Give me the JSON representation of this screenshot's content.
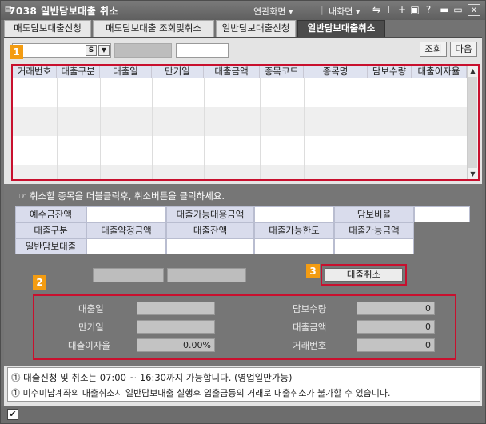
{
  "window": {
    "title": "7038 일반담보대출 취소",
    "menu_related": "연관화면",
    "menu_my": "내화면",
    "close": "x"
  },
  "tabs": [
    {
      "label": "매도담보대출신청",
      "active": false
    },
    {
      "label": "매도담보대출 조회및취소",
      "active": false
    },
    {
      "label": "일반담보대출신청",
      "active": false
    },
    {
      "label": "일반담보대출취소",
      "active": true
    }
  ],
  "filter": {
    "s_label": "S",
    "search_button": "조회",
    "next_button": "다음"
  },
  "grid": {
    "columns": [
      "거래번호",
      "대출구분",
      "대출일",
      "만기일",
      "대출금액",
      "종목코드",
      "종목명",
      "담보수량",
      "대출이자율"
    ],
    "rows": []
  },
  "hint": "☞ 취소할 종목을 더블클릭후, 취소버튼을 클릭하세요.",
  "summary": {
    "deposit_balance_label": "예수금잔액",
    "loanable_collateral_label": "대출가능대용금액",
    "collateral_ratio_label": "담보비율",
    "loan_type_label": "대출구분",
    "loan_agreed_amount_label": "대출약정금액",
    "loan_balance_label": "대출잔액",
    "loan_limit_label": "대출가능한도",
    "loanable_amount_label": "대출가능금액",
    "general_collateral_loan_label": "일반담보대출"
  },
  "cancel_button": "대출취소",
  "detail": {
    "loan_date_label": "대출일",
    "maturity_label": "만기일",
    "interest_label": "대출이자율",
    "interest_value": "0.00%",
    "collateral_qty_label": "담보수량",
    "collateral_qty_value": "0",
    "loan_amount_label": "대출금액",
    "loan_amount_value": "0",
    "trade_no_label": "거래번호",
    "trade_no_value": "0"
  },
  "badges": {
    "one": "1",
    "two": "2",
    "three": "3"
  },
  "notice": {
    "line1": "⓵ 대출신청 및 취소는 07:00 ~ 16:30까지 가능합니다. (영업일만가능)",
    "line2": "⓵ 미수미납계좌의 대출취소시 일반담보대출 실행후 입출금등의 거래로 대출취소가 불가할 수 있습니다."
  },
  "colors": {
    "highlight_border": "#c8102e",
    "badge": "#f39c12",
    "active_tab": "#4b4b4b"
  }
}
